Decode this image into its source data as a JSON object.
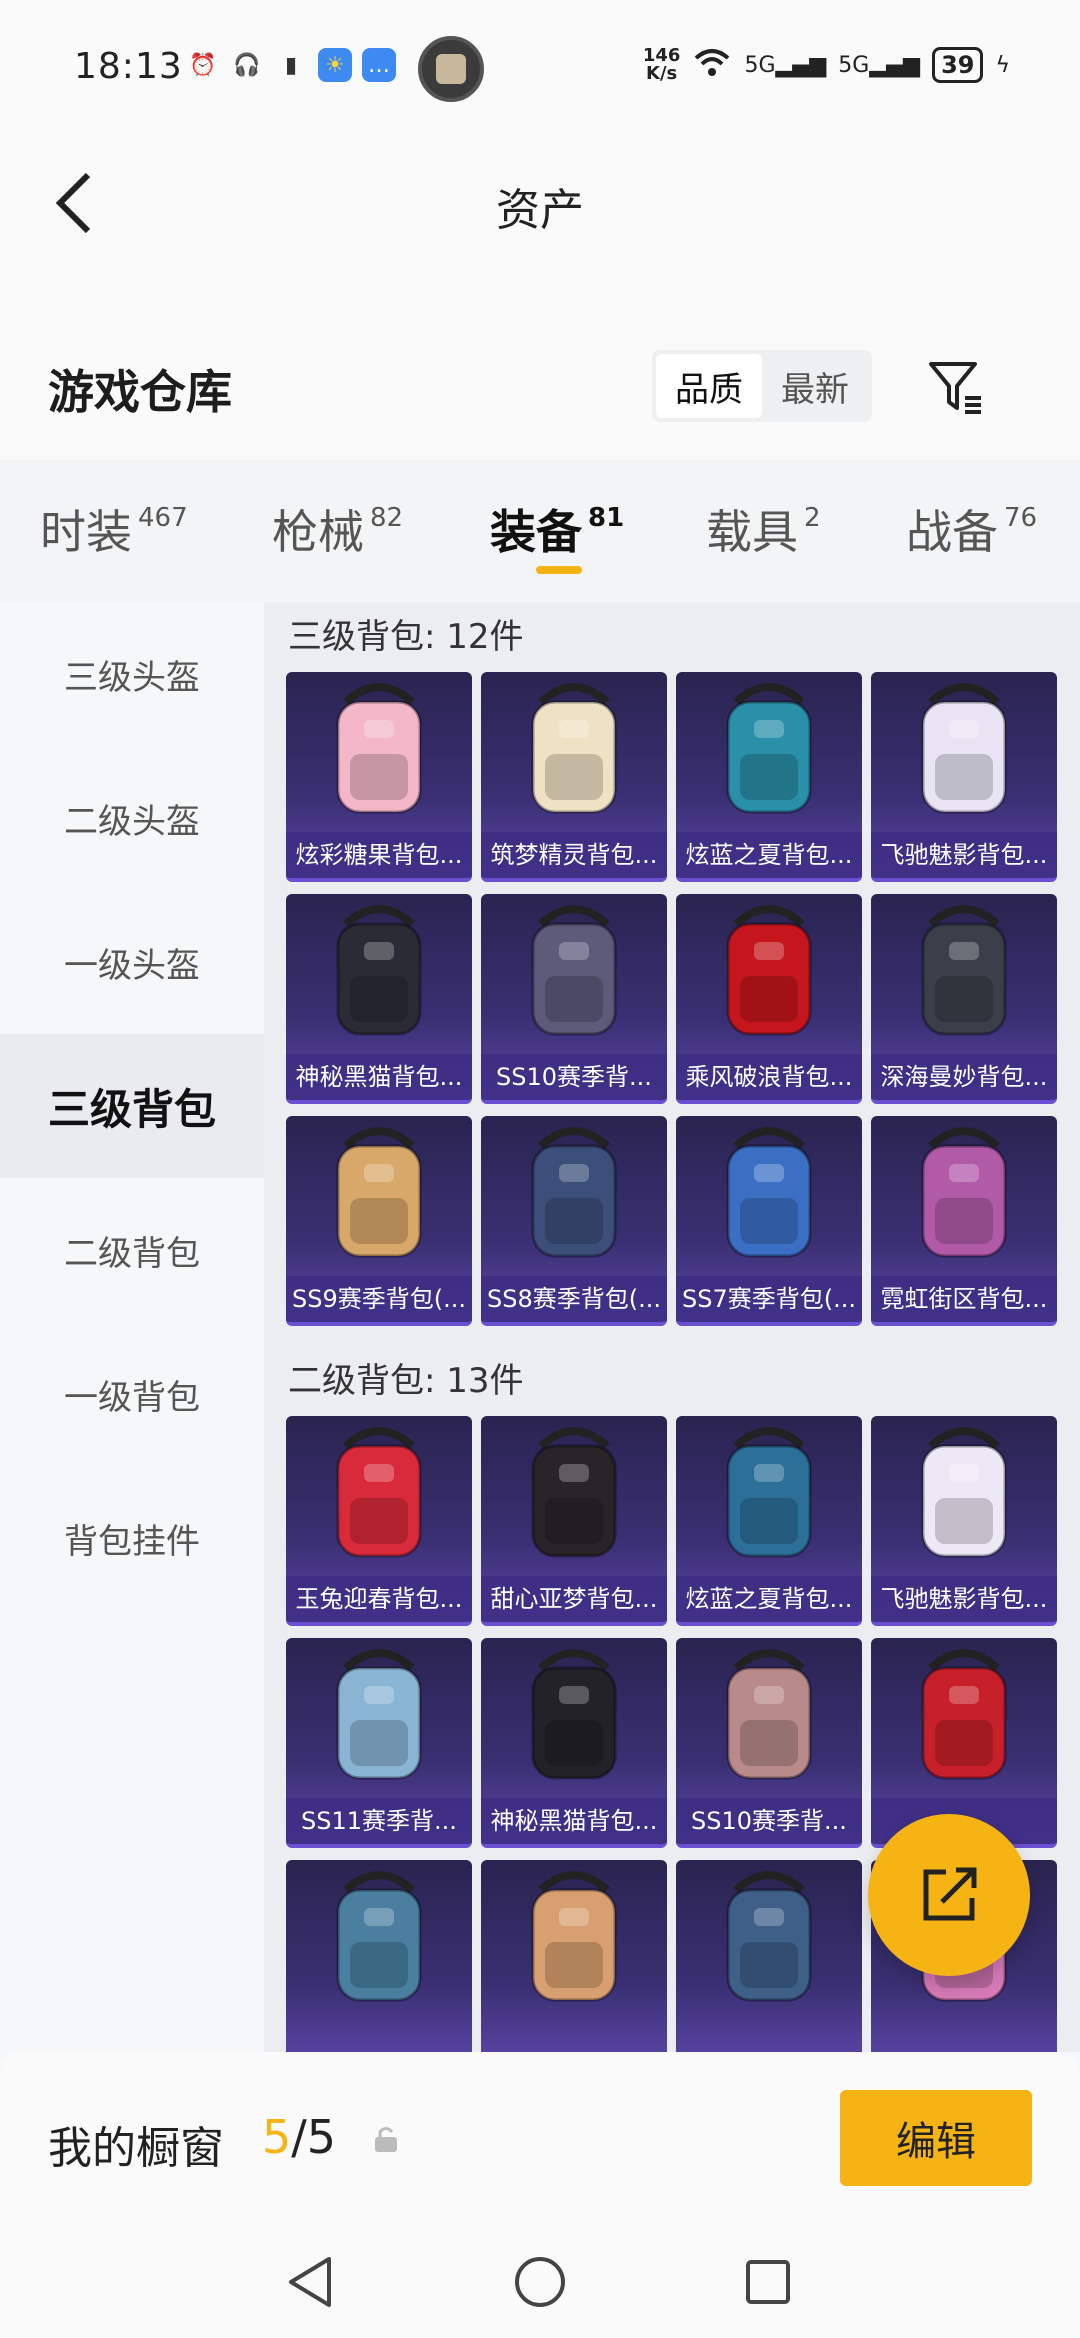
{
  "status_bar": {
    "time": "18:13",
    "net_speed_value": "146",
    "net_speed_unit": "K/s",
    "signal_1": "5G",
    "signal_2": "5G",
    "battery": "39"
  },
  "header": {
    "title": "资产"
  },
  "warehouse": {
    "title": "游戏仓库",
    "sort_options": [
      "品质",
      "最新"
    ],
    "active_sort": "品质"
  },
  "tabs": [
    {
      "label": "时装",
      "count": "467"
    },
    {
      "label": "枪械",
      "count": "82"
    },
    {
      "label": "装备",
      "count": "81"
    },
    {
      "label": "载具",
      "count": "2"
    },
    {
      "label": "战备",
      "count": "76"
    }
  ],
  "sidebar": {
    "items": [
      "三级头盔",
      "二级头盔",
      "一级头盔",
      "三级背包",
      "二级背包",
      "一级背包",
      "背包挂件"
    ],
    "active": "三级背包"
  },
  "groups": [
    {
      "title": "三级背包: 12件",
      "items": [
        {
          "name": "炫彩糖果背包...",
          "color": "#f3b7c8"
        },
        {
          "name": "筑梦精灵背包...",
          "color": "#efe2c4"
        },
        {
          "name": "炫蓝之夏背包...",
          "color": "#2a8fa8"
        },
        {
          "name": "飞驰魅影背包...",
          "color": "#e8e4f4"
        },
        {
          "name": "神秘黑猫背包...",
          "color": "#2b2b35"
        },
        {
          "name": "SS10赛季背...",
          "color": "#5d5a7a"
        },
        {
          "name": "乘风破浪背包...",
          "color": "#c4161c"
        },
        {
          "name": "深海曼妙背包...",
          "color": "#3a3f4a"
        },
        {
          "name": "SS9赛季背包(...",
          "color": "#d8a86a"
        },
        {
          "name": "SS8赛季背包(...",
          "color": "#3c4f7a"
        },
        {
          "name": "SS7赛季背包(...",
          "color": "#3b6fc4"
        },
        {
          "name": "霓虹街区背包...",
          "color": "#b05aa8"
        }
      ]
    },
    {
      "title": "二级背包: 13件",
      "items": [
        {
          "name": "玉兔迎春背包...",
          "color": "#d82a3a"
        },
        {
          "name": "甜心亚梦背包...",
          "color": "#2a2428"
        },
        {
          "name": "炫蓝之夏背包...",
          "color": "#2c6f98"
        },
        {
          "name": "飞驰魅影背包...",
          "color": "#ece8f6"
        },
        {
          "name": "SS11赛季背...",
          "color": "#8ab4d4"
        },
        {
          "name": "神秘黑猫背包...",
          "color": "#232228"
        },
        {
          "name": "SS10赛季背...",
          "color": "#b88a8a"
        },
        {
          "name": "...",
          "color": "#c8202a"
        },
        {
          "name": "",
          "color": "#4a7fa0"
        },
        {
          "name": "",
          "color": "#d8a070"
        },
        {
          "name": "",
          "color": "#3e5f88"
        },
        {
          "name": "",
          "color": "#d67ab8"
        }
      ]
    }
  ],
  "showcase": {
    "label": "我的橱窗",
    "current": "5",
    "total": "/5",
    "edit_label": "编辑"
  }
}
